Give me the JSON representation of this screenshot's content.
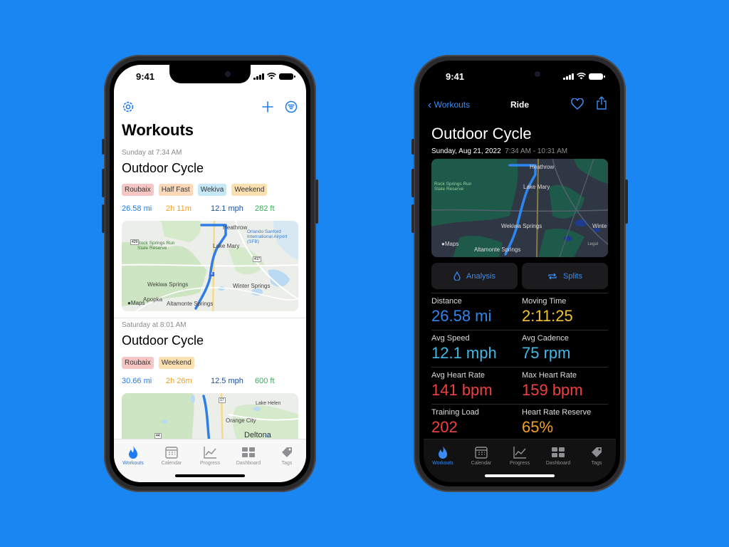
{
  "colors": {
    "background": "#1a86f2",
    "accent": "#1e7cf5",
    "distance": "#1e7cf5",
    "duration": "#f0a020",
    "speed": "#1a4f9e",
    "elevation": "#2fb455"
  },
  "status": {
    "time": "9:41"
  },
  "left": {
    "nav": {
      "settings_icon": "gear-icon",
      "add_icon": "plus-icon",
      "filter_icon": "filter-icon"
    },
    "title": "Workouts",
    "workouts": [
      {
        "when": "Sunday at 7:34 AM",
        "title": "Outdoor Cycle",
        "tags": [
          "Roubaix",
          "Half Fast",
          "Wekiva",
          "Weekend"
        ],
        "distance": "26.58 mi",
        "duration": "2h 11m",
        "speed": "12.1 mph",
        "elevation": "282 ft",
        "map": {
          "labels": [
            "Heathrow",
            "Orlando Sanford International Airport (SFB)",
            "Rock Springs Run State Reserve",
            "Lake Mary",
            "Wekiwa Springs",
            "Winter Springs",
            "Apopka",
            "Altamonte Springs"
          ],
          "road_shields": [
            "429",
            "417",
            "4"
          ],
          "attribution": "Maps"
        }
      },
      {
        "when": "Saturday at 8:01 AM",
        "title": "Outdoor Cycle",
        "tags": [
          "Roubaix",
          "Weekend"
        ],
        "distance": "30.66 mi",
        "duration": "2h 26m",
        "speed": "12.5 mph",
        "elevation": "600 ft",
        "map": {
          "labels": [
            "Lake Helen",
            "Orange City",
            "Deltona"
          ],
          "road_shields": [
            "17",
            "44"
          ]
        }
      }
    ],
    "tabbar": [
      {
        "label": "Workouts",
        "icon": "flame-icon",
        "active": true
      },
      {
        "label": "Calendar",
        "icon": "calendar-icon",
        "active": false
      },
      {
        "label": "Progress",
        "icon": "chart-icon",
        "active": false
      },
      {
        "label": "Dashboard",
        "icon": "grid-icon",
        "active": false
      },
      {
        "label": "Tags",
        "icon": "tag-icon",
        "active": false
      }
    ]
  },
  "right": {
    "nav": {
      "back_label": "Workouts",
      "title": "Ride",
      "favorite_icon": "heart-icon",
      "share_icon": "share-icon"
    },
    "title": "Outdoor Cycle",
    "date": "Sunday, Aug 21, 2022",
    "time_range": "7:34 AM - 10:31 AM",
    "map": {
      "labels": [
        "Heathrow",
        "Rock Springs Run State Reserve",
        "Lake Mary",
        "Wekiwa Springs",
        "Winte",
        "Altamonte Springs"
      ],
      "attribution": "Maps",
      "legal": "Legal"
    },
    "buttons": [
      {
        "label": "Analysis",
        "icon": "drop-icon"
      },
      {
        "label": "Splits",
        "icon": "repeat-icon"
      }
    ],
    "metrics": [
      {
        "label": "Distance",
        "value": "26.58 mi",
        "color": "#2e86f0"
      },
      {
        "label": "Moving Time",
        "value": "2:11:25",
        "color": "#f2c230"
      },
      {
        "label": "Avg Speed",
        "value": "12.1 mph",
        "color": "#40b8e8"
      },
      {
        "label": "Avg Cadence",
        "value": "75 rpm",
        "color": "#40b8e8"
      },
      {
        "label": "Avg Heart Rate",
        "value": "141 bpm",
        "color": "#f04040"
      },
      {
        "label": "Max Heart Rate",
        "value": "159 bpm",
        "color": "#f04040"
      },
      {
        "label": "Training Load",
        "value": "202",
        "color": "#f04040"
      },
      {
        "label": "Heart Rate Reserve",
        "value": "65%",
        "color": "#f5a020"
      }
    ],
    "tabbar": [
      {
        "label": "Workouts",
        "icon": "flame-icon",
        "active": true
      },
      {
        "label": "Calendar",
        "icon": "calendar-icon",
        "active": false
      },
      {
        "label": "Progress",
        "icon": "chart-icon",
        "active": false
      },
      {
        "label": "Dashboard",
        "icon": "grid-icon",
        "active": false
      },
      {
        "label": "Tags",
        "icon": "tag-icon",
        "active": false
      }
    ]
  }
}
